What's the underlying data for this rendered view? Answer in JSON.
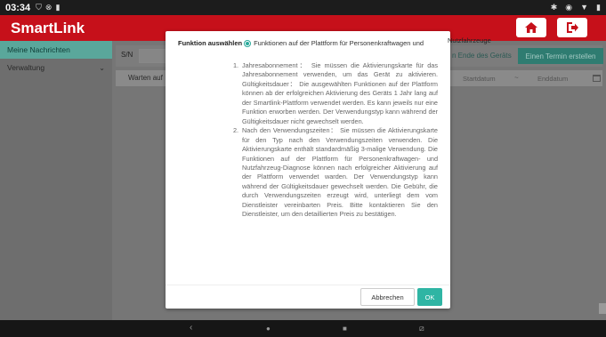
{
  "status_bar": {
    "time": "03:34",
    "icons_left": [
      "shield-icon",
      "cancel-circle-icon",
      "sim-icon"
    ],
    "icons_right": [
      "bluetooth-icon",
      "location-icon",
      "wifi-icon",
      "battery-icon"
    ]
  },
  "app": {
    "title": "SmartLink",
    "brand_color": "#c6101a",
    "accent_color": "#2fb5a4",
    "header_buttons": [
      "home-icon",
      "logout-icon"
    ]
  },
  "sidebar": {
    "items": [
      {
        "label": "Meine Nachrichten",
        "active": true
      },
      {
        "label": "Verwaltung",
        "active": false,
        "icon": "chevron-down-icon"
      }
    ]
  },
  "filters": {
    "sn_label": "S/N",
    "ende_label": "n Ende des Geräts",
    "termin_button": "Einen Termin erstellen",
    "status_label": "Warten auf",
    "start_placeholder": "Startdatum",
    "range_sep": "~",
    "end_placeholder": "Enddatum"
  },
  "dialog": {
    "function_label": "Funktion auswählen",
    "function_option": "Funktionen auf der Plattform für Personenkraftwagen und",
    "function_option_cont": "Nutzfahrzeuge",
    "items": [
      {
        "num": "1.",
        "text": "Jahresabonnement： Sie müssen die Aktivierungskarte für das Jahresabonnement verwenden, um das Gerät zu aktivieren. Gültigkeitsdauer： Die ausgewählten Funktionen auf der Plattform können ab der erfolgreichen Aktivierung des Geräts 1 Jahr lang auf der Smartlink-Plattform verwendet werden. Es kann jeweils nur eine Funktion erworben werden. Der Verwendungstyp kann während der Gültigkeitsdauer nicht gewechselt werden."
      },
      {
        "num": "2.",
        "text": "Nach den Verwendungszeiten： Sie müssen die Aktivierungskarte für den Typ nach den Verwendungszeiten verwenden. Die Aktivierungskarte enthält standardmäßig 3-malige Verwendung. Die Funktionen auf der Plattform für Personenkraftwagen- und Nutzfahrzeug-Diagnose können nach erfolgreicher Aktivierung auf der Plattform verwendet warden. Der Verwendungstyp kann während der Gültigkeitsdauer gewechselt werden. Die Gebühr, die durch Verwendungszeiten erzeugt wird, unterliegt dem vom Dienstleister vereinbarten Preis. Bitte kontaktieren Sie den Dienstleister, um den detaillierten Preis zu bestätigen."
      }
    ],
    "cancel_label": "Abbrechen",
    "ok_label": "OK"
  },
  "nav_bar": {
    "buttons": [
      "back-icon",
      "home-circle-icon",
      "recents-icon",
      "screenshot-icon"
    ]
  }
}
